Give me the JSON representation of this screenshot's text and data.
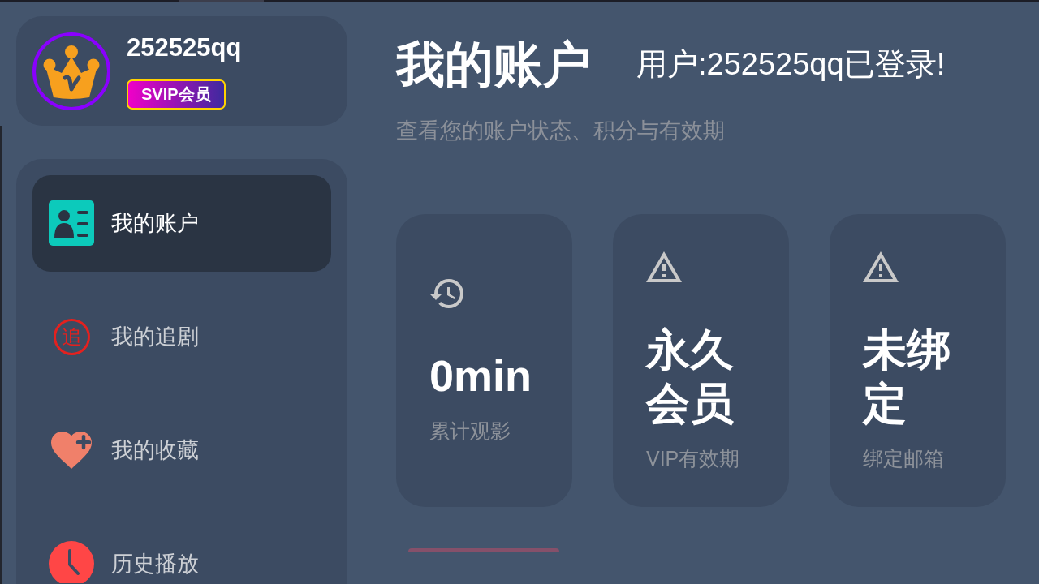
{
  "profile": {
    "username": "252525qq",
    "badge": "SVIP会员"
  },
  "sidebar": {
    "items": [
      {
        "label": "我的账户",
        "kind": "account",
        "selected": true
      },
      {
        "label": "我的追剧",
        "kind": "follow",
        "icon_glyph": "追",
        "selected": false
      },
      {
        "label": "我的收藏",
        "kind": "favorites",
        "selected": false
      },
      {
        "label": "历史播放",
        "kind": "history",
        "selected": false
      }
    ]
  },
  "header": {
    "title": "我的账户",
    "status": "用户:252525qq已登录!",
    "subtitle": "查看您的账户状态、积分与有效期"
  },
  "stats": [
    {
      "kind": "history",
      "value": "0min",
      "label": "累计观影"
    },
    {
      "kind": "warning",
      "value": "永久会员",
      "label": "VIP有效期"
    },
    {
      "kind": "warning",
      "value": "未绑定",
      "label": "绑定邮箱"
    }
  ]
}
